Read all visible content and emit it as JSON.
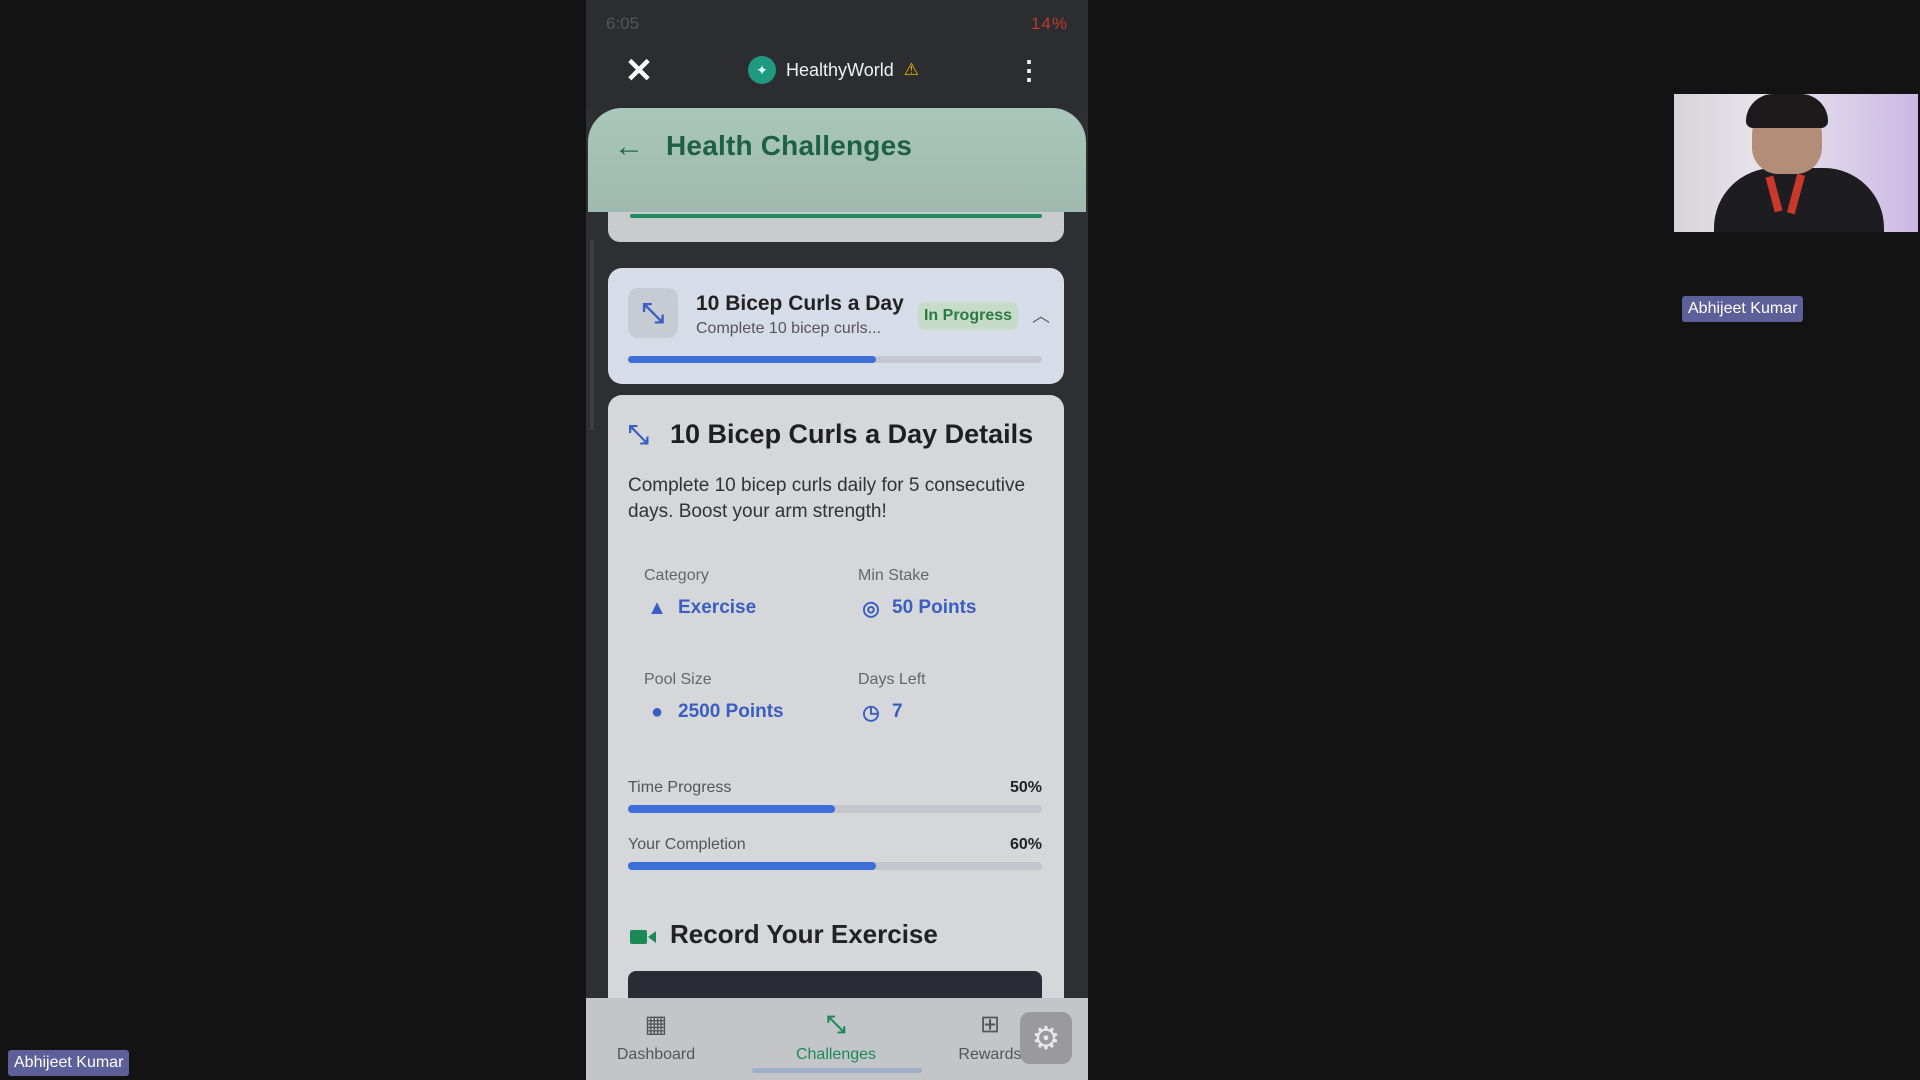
{
  "status_bar": {
    "time": "6:05",
    "right": "14%"
  },
  "browser": {
    "site_title": "HealthyWorld"
  },
  "page": {
    "title": "Health Challenges"
  },
  "challenge_card": {
    "name": "10 Bicep Curls a Day",
    "subtitle": "Complete 10 bicep curls...",
    "status": "In Progress",
    "progress": 0.6
  },
  "details": {
    "title": "10 Bicep Curls a Day Details",
    "description": "Complete 10 bicep curls daily for 5 consecutive days. Boost your arm strength!",
    "stats": {
      "category_label": "Category",
      "category_value": "Exercise",
      "min_stake_label": "Min Stake",
      "min_stake_value": "50 Points",
      "pool_size_label": "Pool Size",
      "pool_size_value": "2500 Points",
      "days_left_label": "Days Left",
      "days_left_value": "7"
    },
    "time_progress": {
      "label": "Time Progress",
      "pct_text": "50%",
      "value": 0.5
    },
    "completion": {
      "label": "Your Completion",
      "pct_text": "60%",
      "value": 0.6
    },
    "record_title": "Record Your Exercise"
  },
  "bottom_nav": {
    "items": [
      {
        "label": "Dashboard",
        "icon": "dashboard-icon"
      },
      {
        "label": "Challenges",
        "icon": "dumbbell-icon"
      },
      {
        "label": "Rewards",
        "icon": "gift-icon"
      }
    ],
    "active": "Challenges"
  },
  "participant": {
    "name": "Abhijeet Kumar"
  },
  "colors": {
    "accent": "#3d6fd6",
    "brand_green": "#1d8a56"
  }
}
